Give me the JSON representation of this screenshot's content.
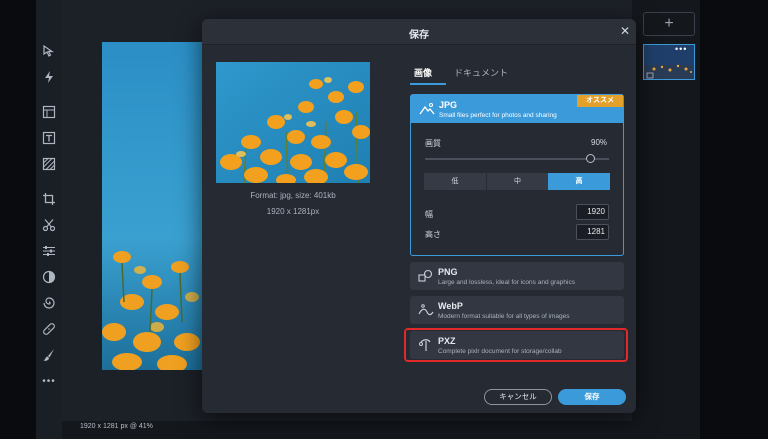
{
  "dialog": {
    "title": "保存",
    "close_icon": "close-icon",
    "preview": {
      "format_text": "Format: jpg, size: 401kb",
      "size_text": "1920 x 1281px"
    },
    "tabs": [
      {
        "label": "画像",
        "active": true
      },
      {
        "label": "ドキュメント",
        "active": false
      }
    ],
    "formats": [
      {
        "name": "JPG",
        "description": "Small files perfect for photos and sharing",
        "icon": "landscape-icon",
        "selected": true
      },
      {
        "name": "PNG",
        "description": "Large and lossless, ideal for icons and graphics",
        "icon": "shapes-icon",
        "selected": false
      },
      {
        "name": "WebP",
        "description": "Modern format suitable for all types of images",
        "icon": "wave-icon",
        "selected": false
      },
      {
        "name": "PXZ",
        "description": "Complete pixlr document for storage/collab",
        "icon": "pxz-icon",
        "selected": false
      }
    ],
    "jpg_options": {
      "badge": "オススメ",
      "quality_label": "画質",
      "quality_value": "90%",
      "quality_fraction": 0.9,
      "levels": [
        "低",
        "中",
        "高"
      ],
      "selected_level": "高",
      "width_label": "幅",
      "width_value": "1920",
      "height_label": "高さ",
      "height_value": "1281"
    },
    "buttons": {
      "cancel": "キャンセル",
      "save": "保存"
    }
  },
  "editor": {
    "status_text": "1920 x 1281 px @ 41%",
    "add_layer_label": "+",
    "layer_more": "•••",
    "tools": [
      "arrange-icon",
      "quick-edit-icon",
      "layers-template-icon",
      "text-icon",
      "pattern-icon",
      "crop-icon",
      "cutout-icon",
      "adjust-icon",
      "filter-icon",
      "liquify-icon",
      "heal-icon",
      "brush-icon",
      "more-icon"
    ]
  },
  "colors": {
    "accent": "#3b9ad9",
    "badge": "#e3a12b",
    "highlight": "#e02a2a",
    "dialog_bg": "#262a32"
  }
}
